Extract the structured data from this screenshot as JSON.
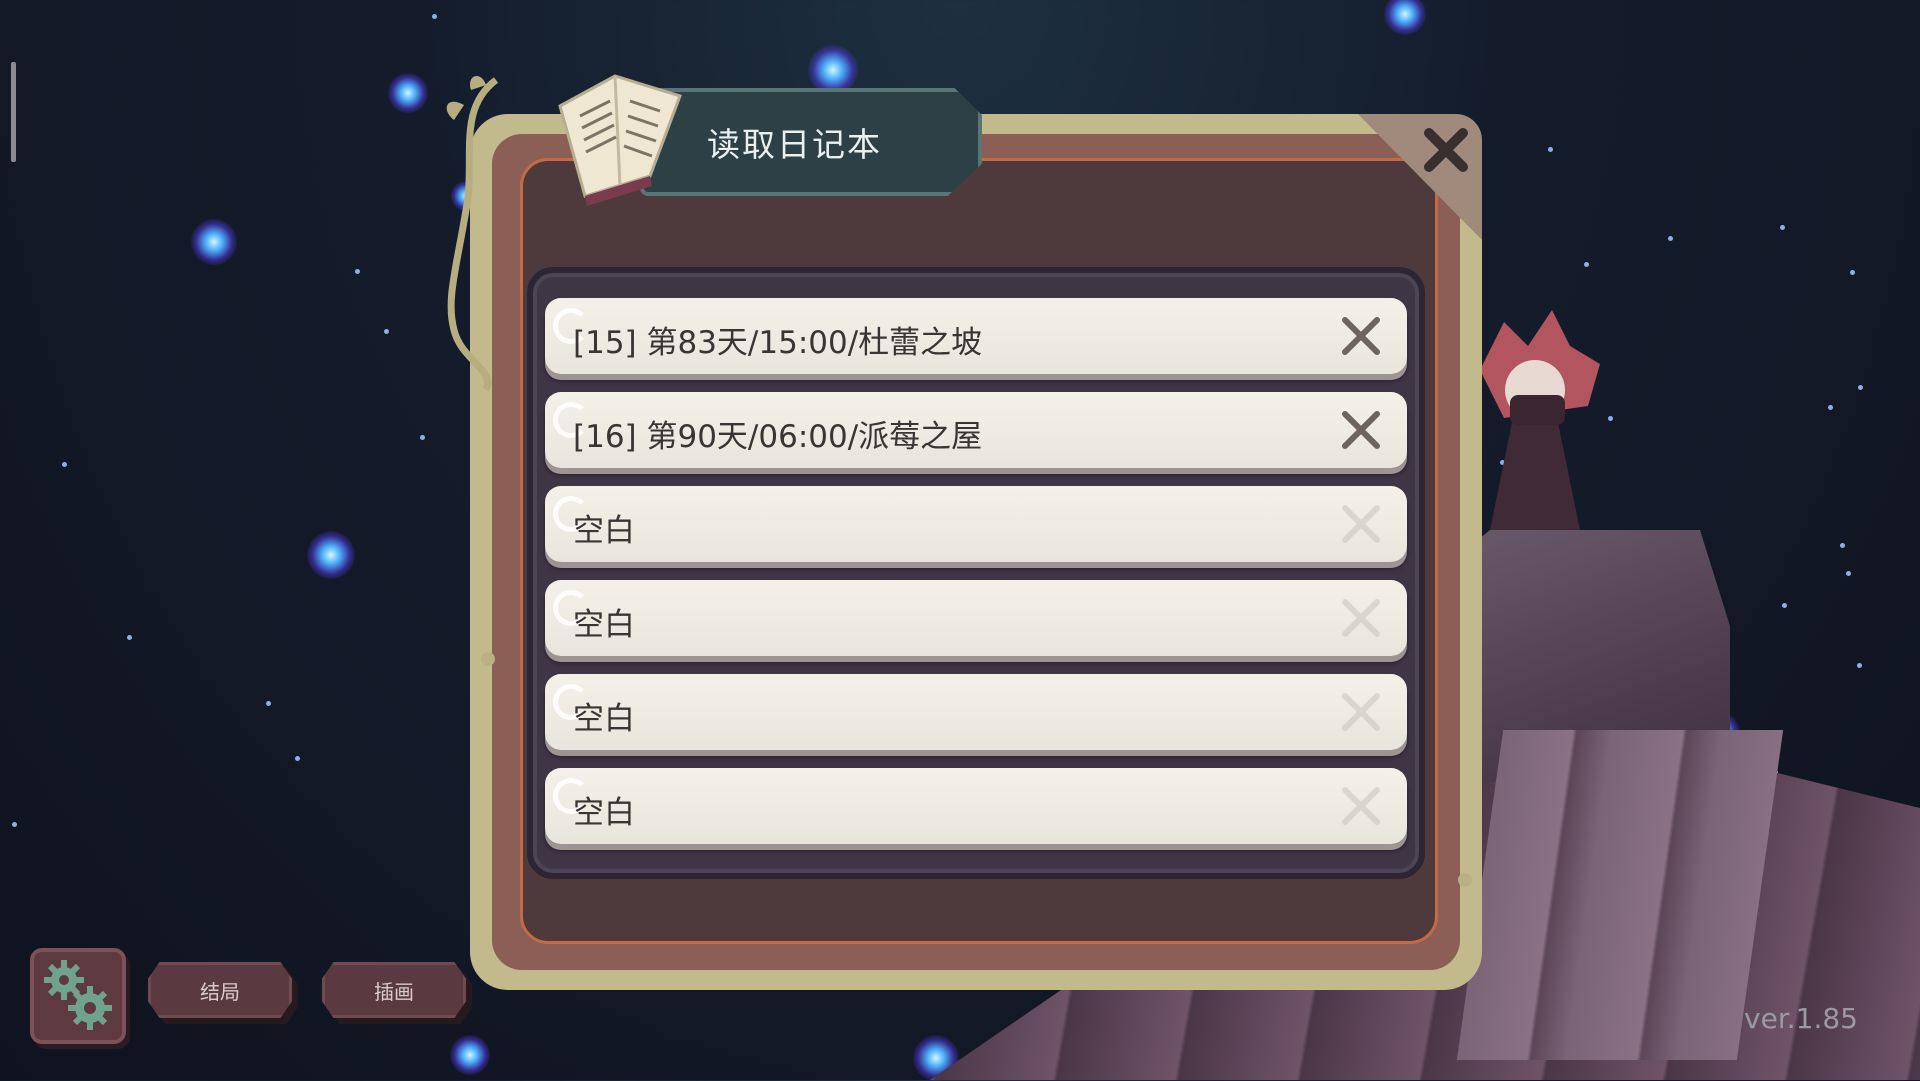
{
  "dialog": {
    "title": "读取日记本",
    "close_icon": "close-x-icon",
    "book_icon": "open-book-icon"
  },
  "save_slots": [
    {
      "label": "[15] 第83天/15:00/杜蕾之坡",
      "deletable": true
    },
    {
      "label": "[16] 第90天/06:00/派莓之屋",
      "deletable": true
    },
    {
      "label": "空白",
      "deletable": false
    },
    {
      "label": "空白",
      "deletable": false
    },
    {
      "label": "空白",
      "deletable": false
    },
    {
      "label": "空白",
      "deletable": false
    }
  ],
  "bottom_bar": {
    "settings_icon": "gears-icon",
    "endings_label": "结局",
    "gallery_label": "插画"
  },
  "version": "ver.1.85",
  "colors": {
    "frame_outer": "#c2b98c",
    "frame_inner": "#4e3a3c",
    "slot_bg": "#f1efe6",
    "title_plate": "#2d4046"
  }
}
